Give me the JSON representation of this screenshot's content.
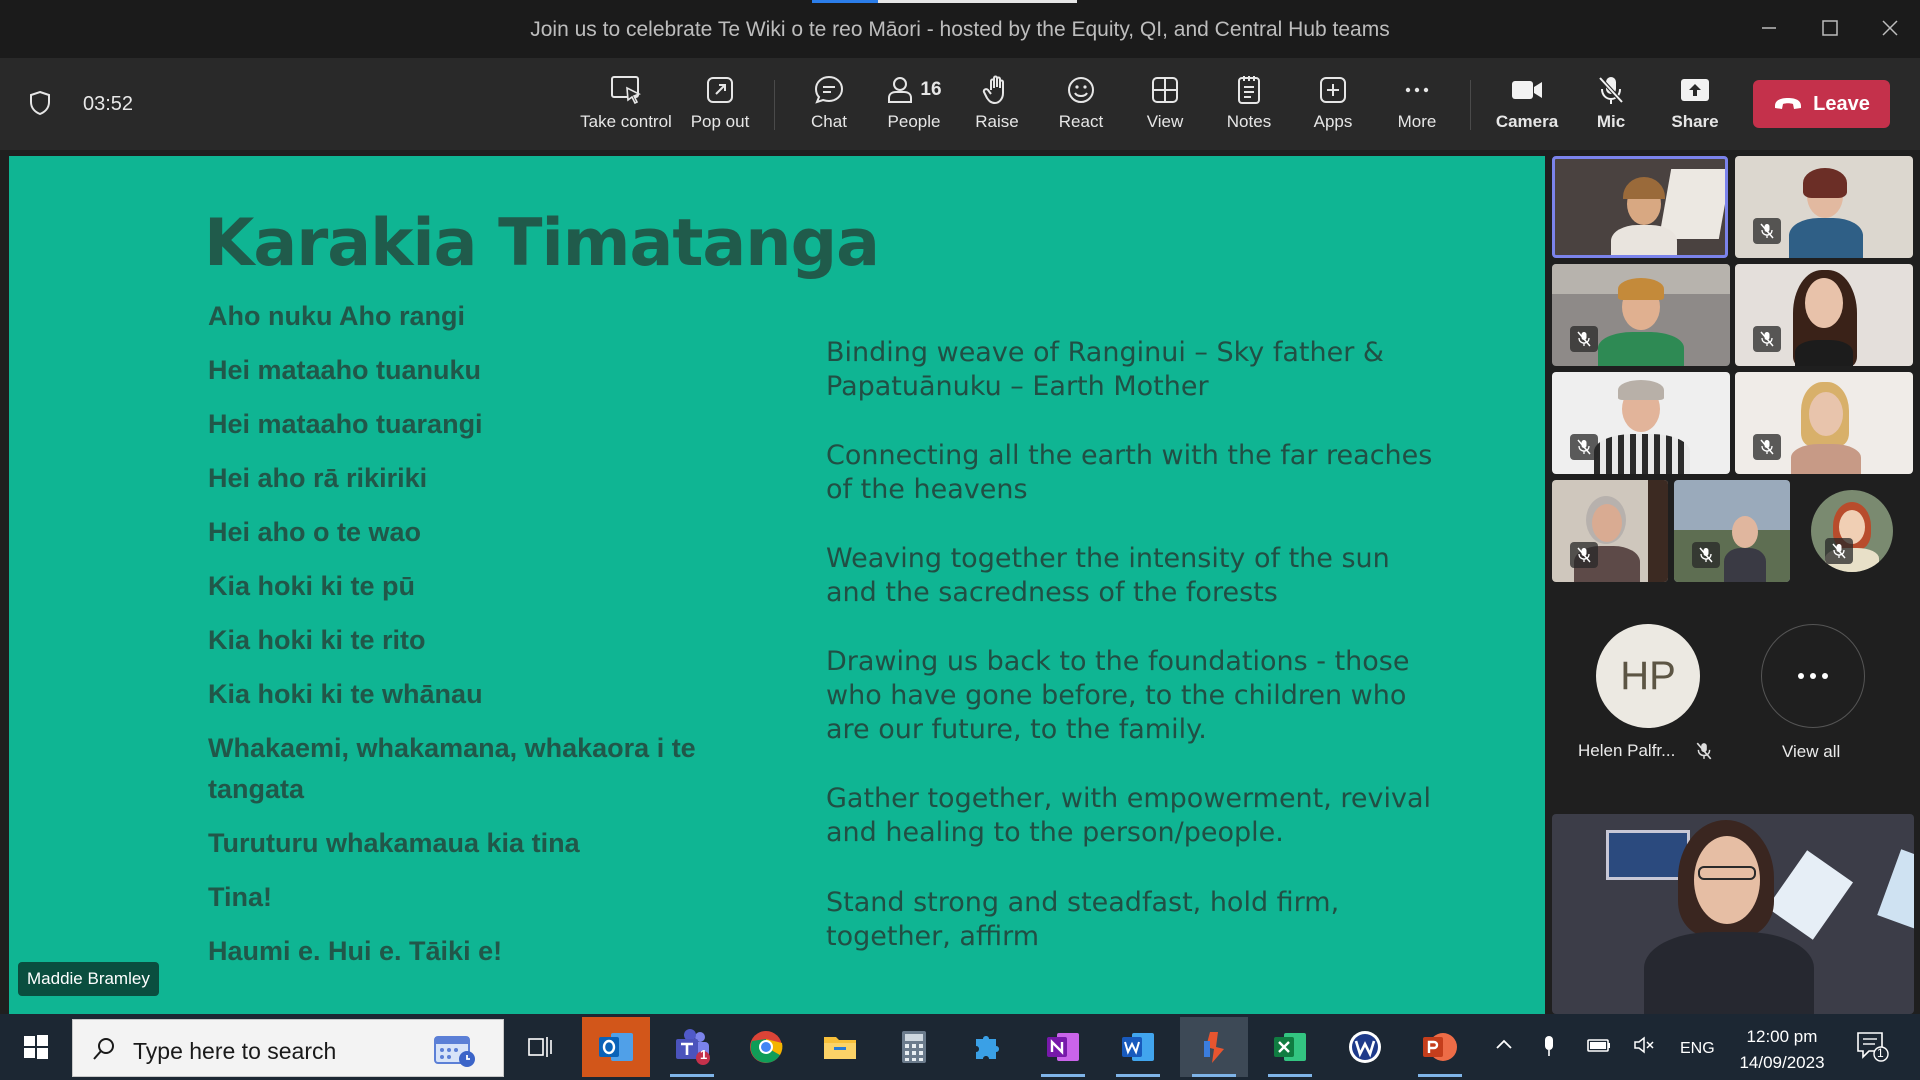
{
  "window": {
    "title": "Join us to celebrate Te Wiki o te reo Māori - hosted by the Equity, QI, and Central Hub teams"
  },
  "toolbar": {
    "timer": "03:52",
    "take_control": "Take control",
    "pop_out": "Pop out",
    "chat": "Chat",
    "people": "People",
    "people_count": "16",
    "raise": "Raise",
    "react": "React",
    "view": "View",
    "notes": "Notes",
    "apps": "Apps",
    "more": "More",
    "camera": "Camera",
    "mic": "Mic",
    "share": "Share",
    "leave": "Leave"
  },
  "slide": {
    "title": "Karakia Timatanga",
    "maori_lines": [
      "Aho nuku Aho rangi",
      "Hei mataaho tuanuku",
      "Hei mataaho tuarangi",
      "Hei aho rā rikiriki",
      "Hei aho o te wao",
      "Kia hoki ki te pū",
      "Kia hoki ki te rito",
      "Kia hoki ki te whānau",
      "Whakaemi, whakamana, whakaora i te tangata",
      "Turuturu whakamaua kia tina",
      "Tina!",
      "Haumi e. Hui e. Tāiki e!"
    ],
    "english_lines": [
      "Binding weave of Ranginui – Sky father & Papatuānuku – Earth Mother",
      "Connecting all the earth with the far reaches of the heavens",
      "Weaving together the intensity of the sun and the sacredness of the forests",
      "Drawing us back to the foundations - those who have gone before, to the children who are our future, to the family.",
      "Gather together, with empowerment, revival and healing to the person/people.",
      "Stand strong and steadfast, hold firm, together, affirm"
    ],
    "presenter_name": "Maddie Bramley"
  },
  "participants": {
    "avatar_initials": "HP",
    "avatar_name": "Helen Palfr...",
    "view_all": "View all"
  },
  "taskbar": {
    "search_placeholder": "Type here to search",
    "teams_badge": "1",
    "language": "ENG",
    "time": "12:00 pm",
    "date": "14/09/2023",
    "notification_count": "1"
  },
  "colors": {
    "slide_bg": "#0fb593",
    "slide_text": "#215749",
    "leave_red": "#c4314b",
    "active_speaker_border": "#7b83eb"
  }
}
